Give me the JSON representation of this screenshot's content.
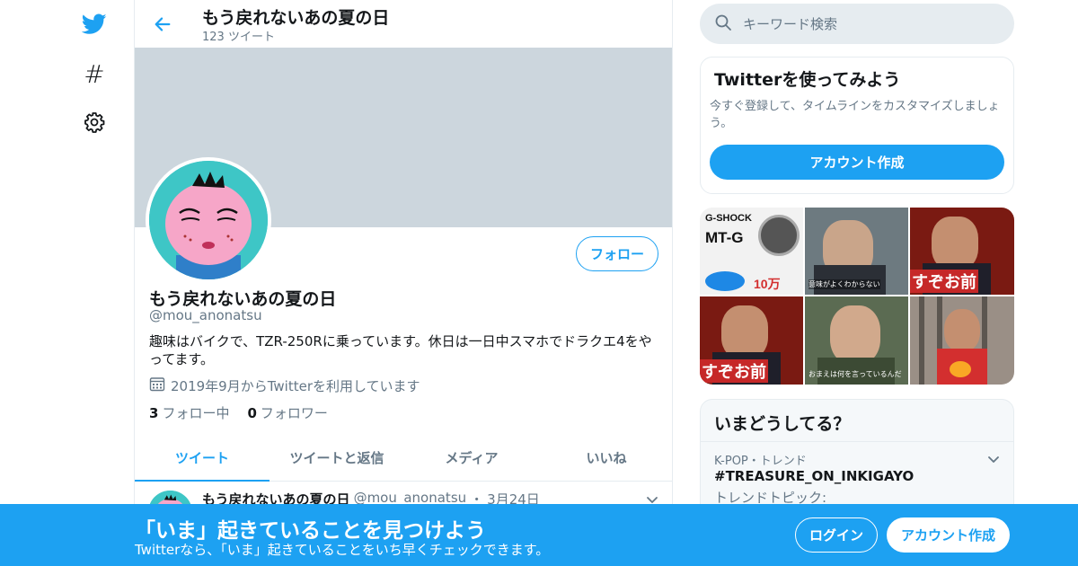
{
  "header": {
    "title": "もう戻れないあの夏の日",
    "tweet_count": "123 ツイート"
  },
  "profile": {
    "name": "もう戻れないあの夏の日",
    "handle": "@mou_anonatsu",
    "bio": "趣味はバイクで、TZR-250Rに乗っています。休日は一日中スマホでドラクエ4をやってます。",
    "joined": "2019年9月からTwitterを利用しています",
    "following_count": "3",
    "following_label": "フォロー中",
    "followers_count": "0",
    "followers_label": "フォロワー",
    "follow_button": "フォロー"
  },
  "tabs": [
    {
      "label": "ツイート",
      "active": true
    },
    {
      "label": "ツイートと返信",
      "active": false
    },
    {
      "label": "メディア",
      "active": false
    },
    {
      "label": "いいね",
      "active": false
    }
  ],
  "tweet": {
    "name": "もう戻れないあの夏の日",
    "handle": "@mou_anonatsu",
    "separator": "・",
    "date": "3月24日"
  },
  "search": {
    "placeholder": "キーワード検索"
  },
  "signup_card": {
    "title": "Twitterを使ってみよう",
    "description": "今すぐ登録して、タイムラインをカスタマイズしましょう。",
    "button": "アカウント作成"
  },
  "media_tiles": [
    {
      "caption": "G-SHOCK",
      "caption2": "MT-G",
      "caption3": "10万",
      "icon": "watch-ad-image"
    },
    {
      "caption": "意味がよくわからない",
      "icon": "press-conference-image"
    },
    {
      "caption": "すぞお前",
      "icon": "tv-show-image"
    },
    {
      "caption": "すぞお前",
      "icon": "tv-show-image"
    },
    {
      "caption": "おまえは何を言っているんだ",
      "icon": "man-portrait-image"
    },
    {
      "caption": "",
      "icon": "fighter-in-cage-image"
    }
  ],
  "trends": {
    "title": "いまどうしてる？",
    "items": [
      {
        "meta": "K-POP・トレンド",
        "name": "#TREASURE_ON_INKIGAYO",
        "sub": "トレンドトピック:"
      }
    ]
  },
  "bottom_bar": {
    "title": "「いま」起きていることを見つけよう",
    "subtitle": "Twitterなら、「いま」起きていることをいち早くチェックできます。",
    "login": "ログイン",
    "signup": "アカウント作成"
  },
  "colors": {
    "accent": "#1da1f2",
    "banner": "#ccd6dd",
    "muted_text": "#657786",
    "border": "#e6ecf0"
  }
}
